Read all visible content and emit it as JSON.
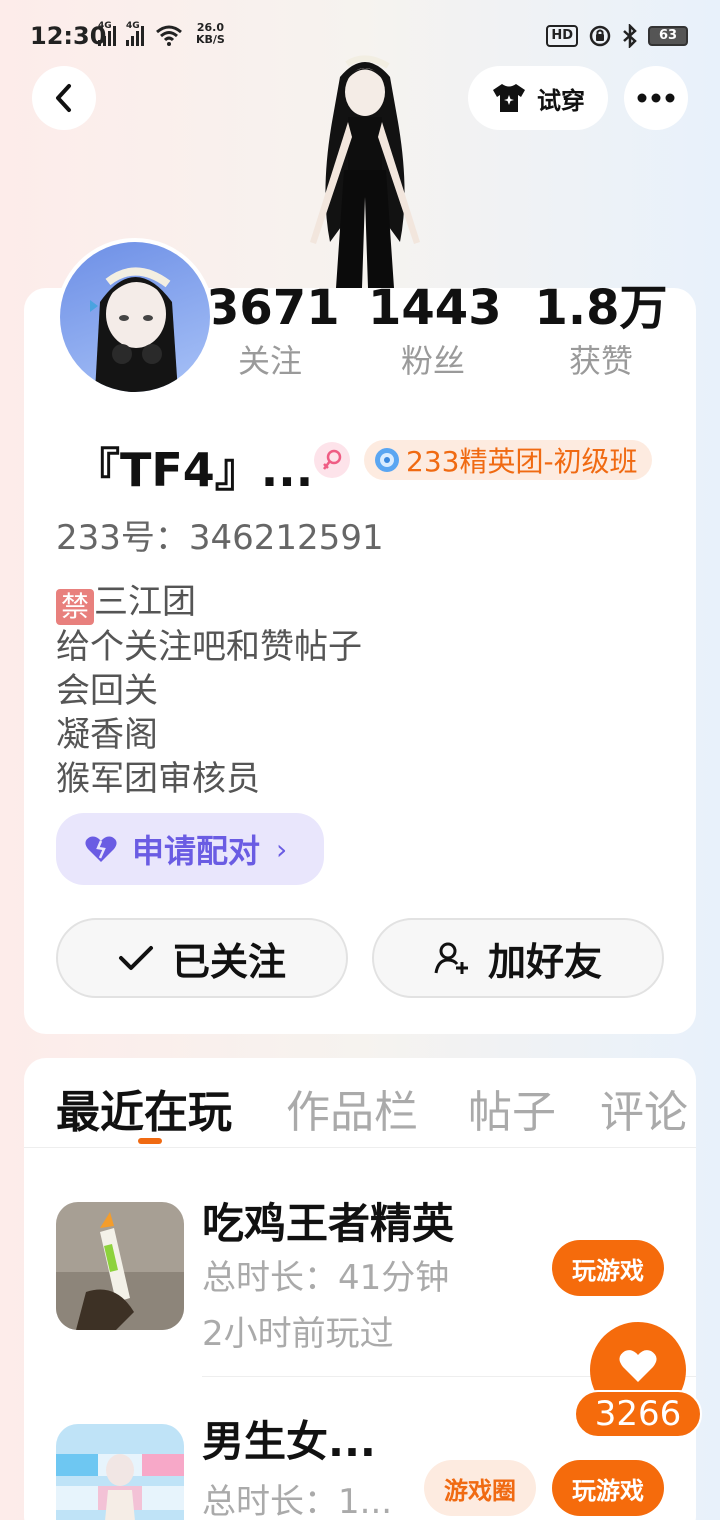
{
  "status_bar": {
    "time": "12:30",
    "signal1_label": "4G",
    "signal2_label": "4G",
    "net_speed_value": "26.0",
    "net_speed_unit": "KB/S",
    "hd_label": "HD",
    "battery": "63"
  },
  "header": {
    "tryon_label": "试穿"
  },
  "stats": [
    {
      "value": "3671",
      "label": "关注"
    },
    {
      "value": "1443",
      "label": "粉丝"
    },
    {
      "value": "1.8万",
      "label": "获赞"
    }
  ],
  "profile": {
    "nickname": "『TF4』...",
    "badge": "233精英团-初级班",
    "uid": "233号：346212591",
    "bio_ban_tag": "禁",
    "bio_lines": [
      "三江团",
      "给个关注吧和赞帖子",
      "会回关",
      "凝香阁",
      "猴军团审核员"
    ],
    "pair_label": "申请配对",
    "pair_chevron": "›",
    "follow_label": "已关注",
    "add_friend_label": "加好友"
  },
  "tabs": [
    {
      "label": "最近在玩",
      "active": true
    },
    {
      "label": "作品栏",
      "active": false
    },
    {
      "label": "帖子",
      "active": false
    },
    {
      "label": "评论",
      "active": false
    }
  ],
  "games": [
    {
      "title": "吃鸡王者精英",
      "duration": "总时长：41分钟",
      "last_played": "2小时前玩过",
      "play_label": "玩游戏"
    },
    {
      "title": "男生女...",
      "duration": "总时长：1...",
      "circle_label": "游戏圈",
      "play_label": "玩游戏"
    }
  ],
  "like": {
    "count": "3266"
  },
  "colors": {
    "accent": "#f56b0c",
    "pair_purple": "#6a5ce3",
    "badge_orange": "#f06a12"
  }
}
